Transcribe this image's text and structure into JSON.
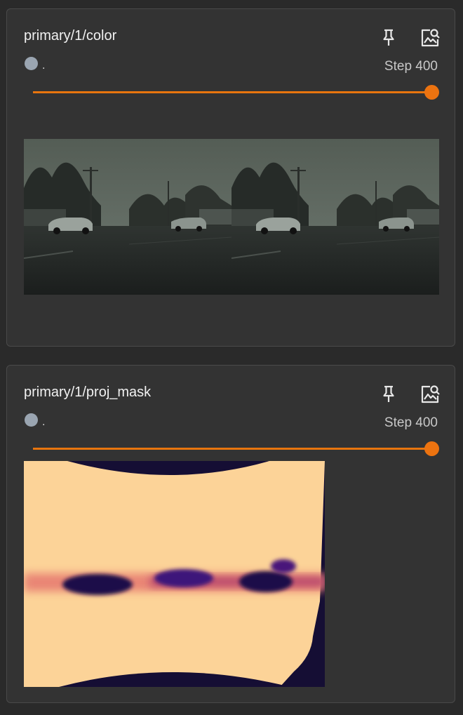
{
  "cards": [
    {
      "title": "primary/1/color",
      "run_suffix": ".",
      "step_label": "Step 400",
      "slider_value": 1.0,
      "run_color": "#9aa5b1",
      "accent_color": "#e8750e",
      "icons": [
        "pin-icon",
        "image-search-icon"
      ]
    },
    {
      "title": "primary/1/proj_mask",
      "run_suffix": ".",
      "step_label": "Step 400",
      "slider_value": 1.0,
      "run_color": "#9aa5b1",
      "accent_color": "#e8750e",
      "icons": [
        "pin-icon",
        "image-search-icon"
      ]
    }
  ]
}
